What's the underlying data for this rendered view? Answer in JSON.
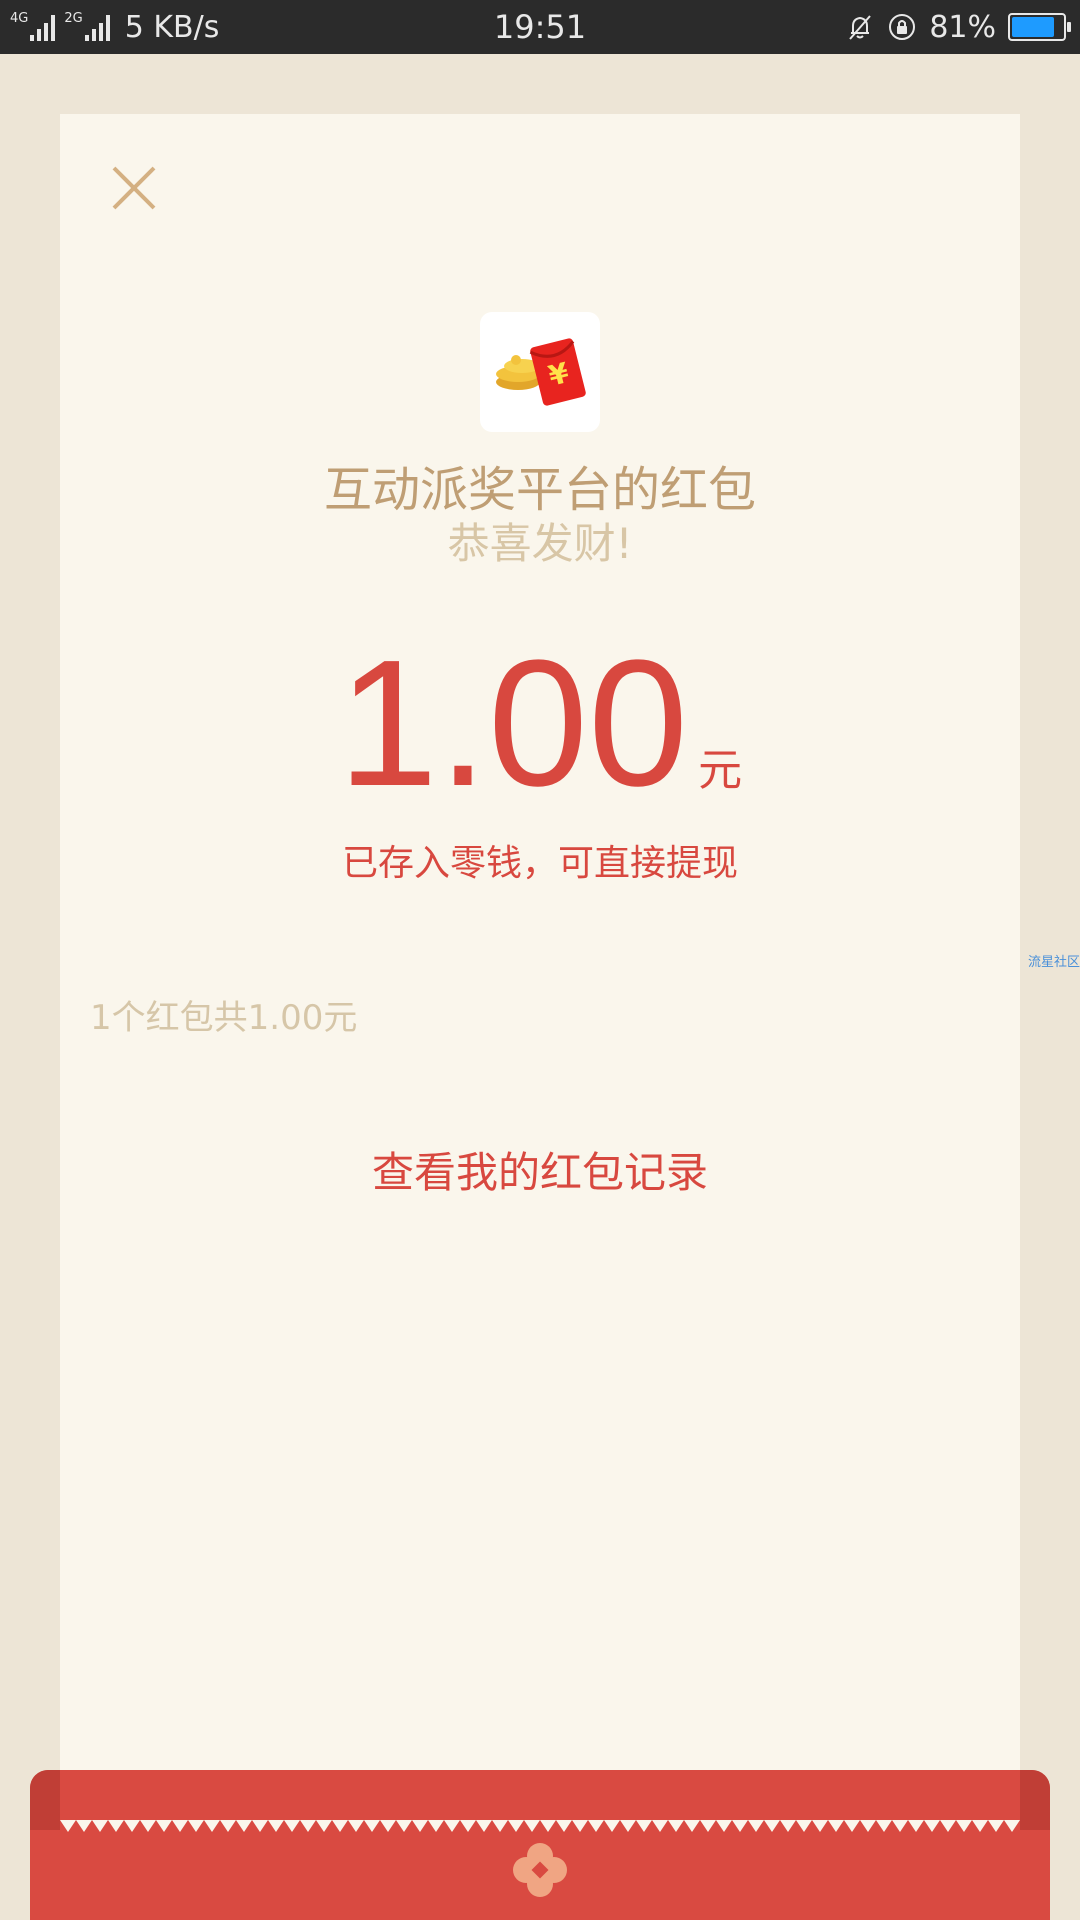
{
  "status_bar": {
    "net1": "4G",
    "net2": "2G",
    "speed": "5 KB/s",
    "time": "19:51",
    "battery_pct": "81%",
    "battery_level": 0.81,
    "icons": [
      "mute-bell-icon",
      "rotation-lock-icon",
      "battery-icon"
    ]
  },
  "card": {
    "close_icon": "close-icon",
    "app_icon": "red-envelope-coins-icon",
    "sender": "互动派奖平台的红包",
    "greeting": "恭喜发财!",
    "amount": "1.00",
    "unit": "元",
    "note": "已存入零钱，可直接提现",
    "summary": "1个红包共1.00元",
    "records_link": "查看我的红包记录"
  },
  "watermark": "流星社区",
  "colors": {
    "accent_red": "#d8483f",
    "gold_text": "#bf9e74",
    "card_bg": "#faf6ec",
    "page_bg": "#ede5d6"
  }
}
